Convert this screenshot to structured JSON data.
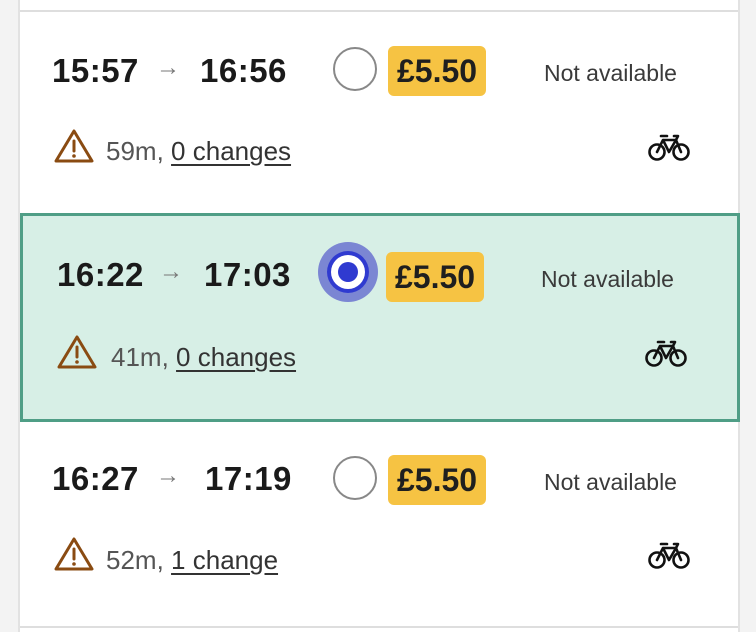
{
  "journeys": [
    {
      "depart": "15:57",
      "arrive": "16:56",
      "price": "£5.50",
      "availability": "Not available",
      "duration": "59m,",
      "changes": "0 changes",
      "selected": false
    },
    {
      "depart": "16:22",
      "arrive": "17:03",
      "price": "£5.50",
      "availability": "Not available",
      "duration": "41m,",
      "changes": "0 changes",
      "selected": true
    },
    {
      "depart": "16:27",
      "arrive": "17:19",
      "price": "£5.50",
      "availability": "Not available",
      "duration": "52m,",
      "changes": "1 change",
      "selected": false
    }
  ],
  "icons": {
    "arrow": "right-arrow-icon",
    "warning": "warning-triangle-icon",
    "bike": "bicycle-icon"
  },
  "colors": {
    "price_bg": "#f6c343",
    "selected_bg": "#d7efe6",
    "selected_border": "#4f9e86",
    "radio_selected": "#2f3ad0",
    "warning": "#8a4b12"
  }
}
